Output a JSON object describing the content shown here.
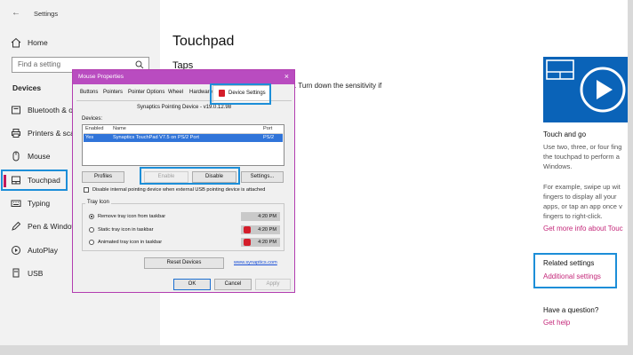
{
  "window": {
    "app_title": "Settings"
  },
  "sidebar": {
    "home": "Home",
    "search_placeholder": "Find a setting",
    "section": "Devices",
    "items": [
      {
        "label": "Bluetooth & o",
        "icon": "bluetooth-icon"
      },
      {
        "label": "Printers & sca",
        "icon": "printer-icon"
      },
      {
        "label": "Mouse",
        "icon": "mouse-icon"
      },
      {
        "label": "Touchpad",
        "icon": "touchpad-icon"
      },
      {
        "label": "Typing",
        "icon": "keyboard-icon"
      },
      {
        "label": "Pen & Window",
        "icon": "pen-icon"
      },
      {
        "label": "AutoPlay",
        "icon": "autoplay-icon"
      },
      {
        "label": "USB",
        "icon": "usb-icon"
      }
    ]
  },
  "main": {
    "title": "Touchpad",
    "subtitle": "Taps",
    "text": ". Turn down the sensitivity if"
  },
  "right": {
    "touch_heading": "Touch and go",
    "touch_lines": [
      "Use two, three, or four fing",
      "the touchpad to perform a",
      "Windows."
    ],
    "example_lines": [
      "For example, swipe up wit",
      "fingers to display all your",
      "apps, or tap an app once v",
      "fingers to right-click."
    ],
    "more_info_link": "Get more info about Touc",
    "related_heading": "Related settings",
    "additional_link": "Additional settings",
    "question_heading": "Have a question?",
    "help_link": "Get help"
  },
  "dialog": {
    "title": "Mouse Properties",
    "close": "×",
    "tabs": [
      "Buttons",
      "Pointers",
      "Pointer Options",
      "Wheel",
      "Hardware",
      "Device Settings"
    ],
    "device_name": "Synaptics Pointing Device - v19.0.12.98",
    "devices_label": "Devices:",
    "columns": [
      "Enabled",
      "Name",
      "Port"
    ],
    "row": {
      "enabled": "Yes",
      "name": "Synaptics TouchPad V7.5 on PS/2 Port",
      "port": "PS/2"
    },
    "buttons": {
      "profiles": "Profiles",
      "enable": "Enable",
      "disable": "Disable",
      "settings": "Settings..."
    },
    "disable_checkbox": "Disable internal pointing device when external USB pointing device is attached",
    "tray_group": "Tray Icon",
    "tray_options": [
      "Remove tray icon from taskbar",
      "Static tray icon in taskbar",
      "Animated tray icon in taskbar"
    ],
    "tray_selected": 0,
    "tray_time": "4:20 PM",
    "reset_button": "Reset Devices",
    "link": "www.synaptics.com",
    "ok": "OK",
    "cancel": "Cancel",
    "apply": "Apply"
  },
  "colors": {
    "accent_link": "#c4287a",
    "highlight": "#1c8ed8",
    "dialog_title": "#b94cc0",
    "video_blue": "#0a63b8"
  }
}
